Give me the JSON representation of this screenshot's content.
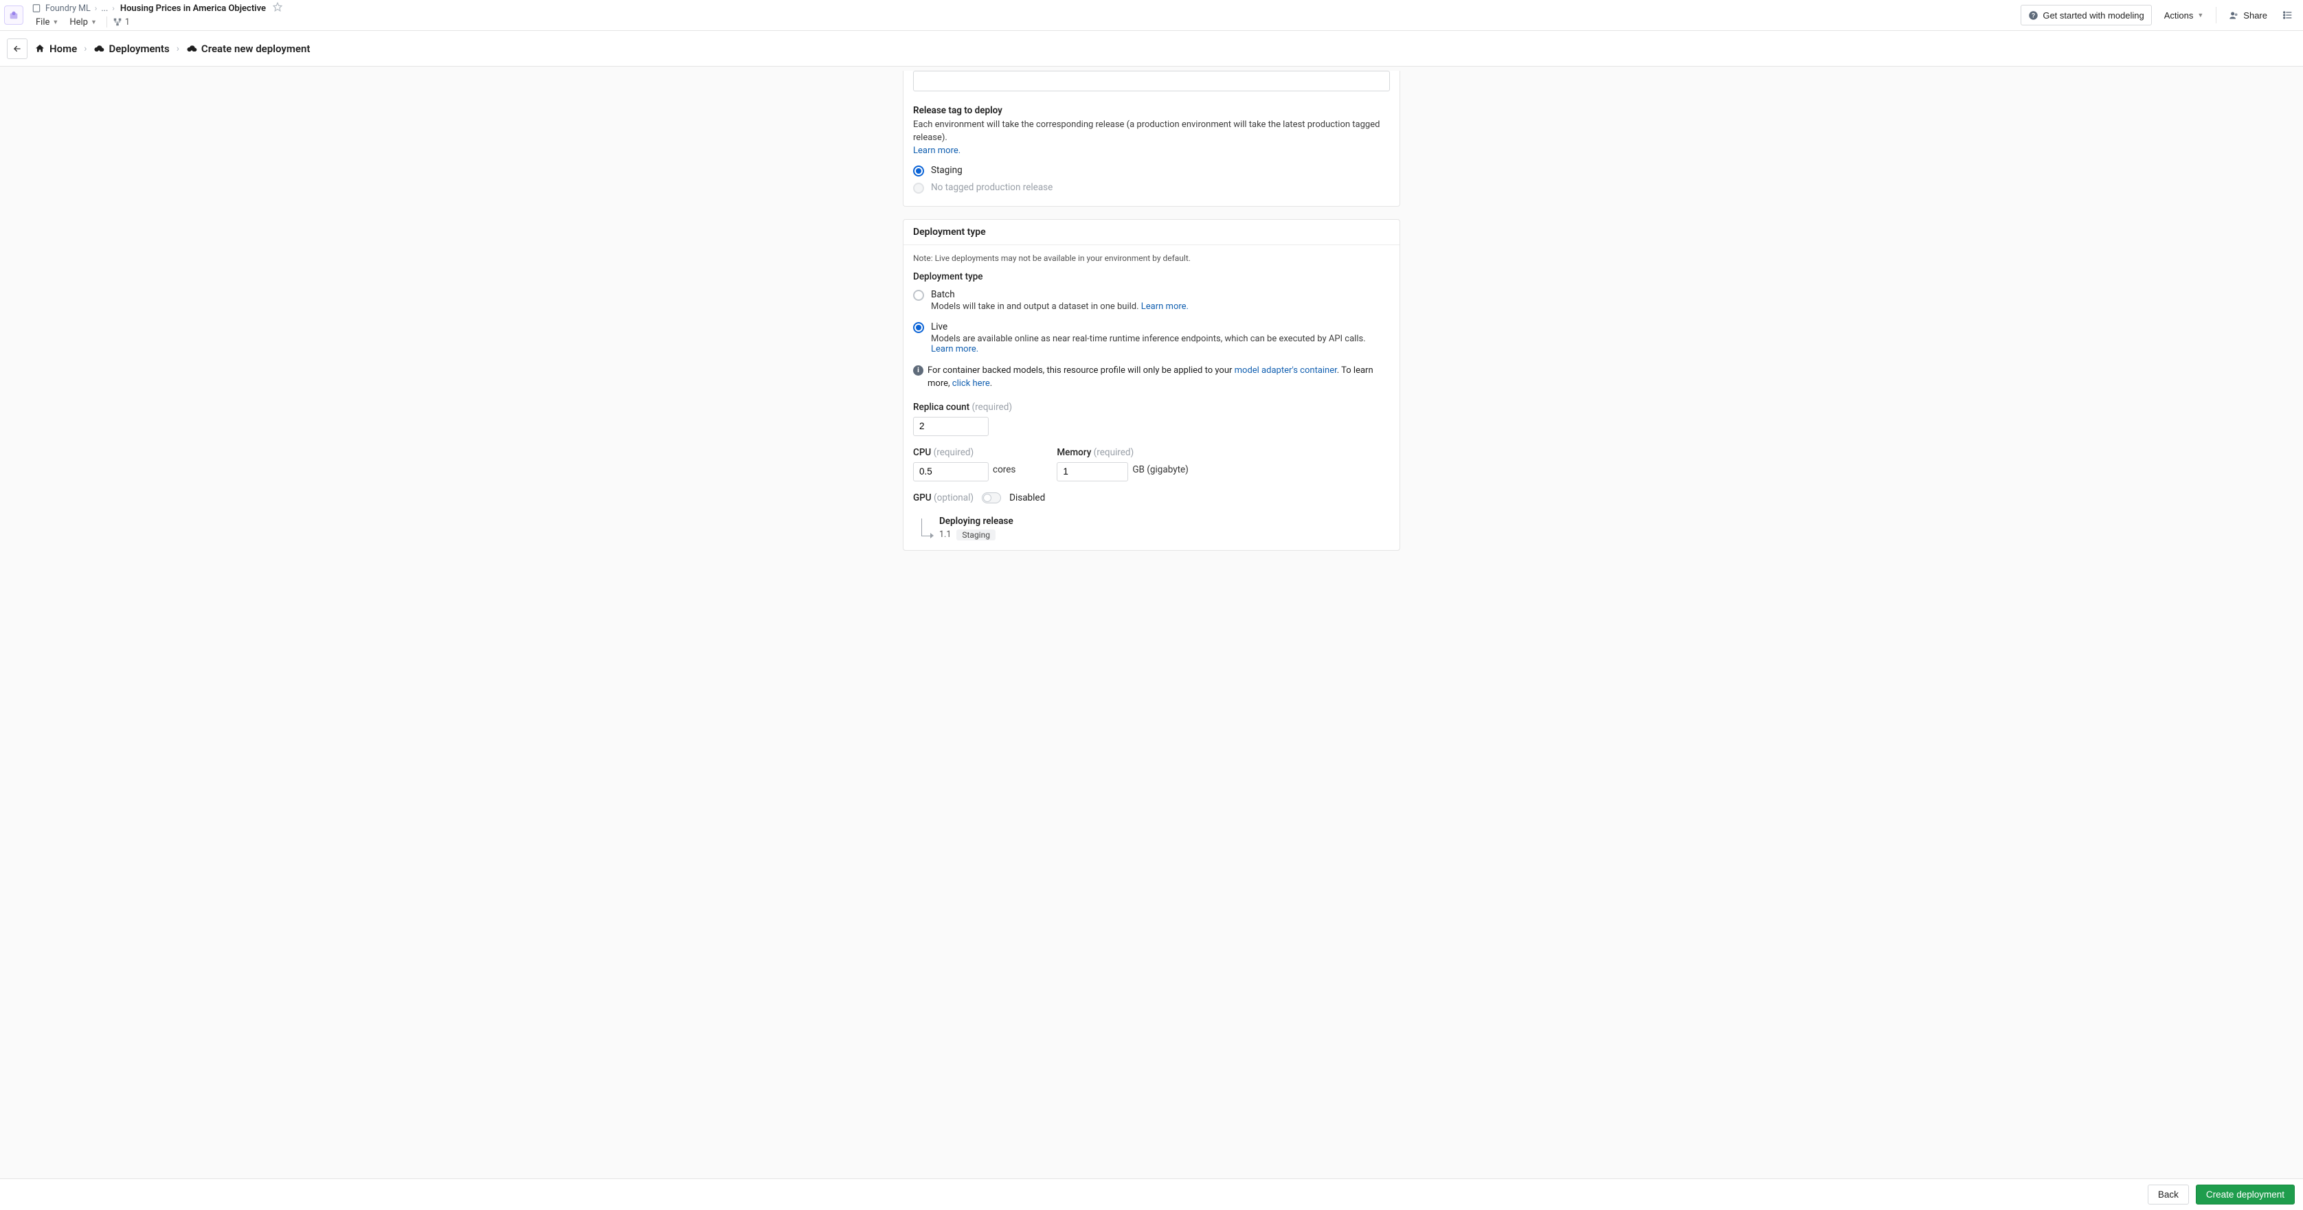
{
  "header": {
    "crumb_root": "Foundry ML",
    "crumb_trunc": "...",
    "crumb_title": "Housing Prices in America Objective",
    "menus": {
      "file": "File",
      "help": "Help",
      "user_count": "1"
    },
    "get_started": "Get started with modeling",
    "actions": "Actions",
    "share": "Share"
  },
  "nav": {
    "home": "Home",
    "deployments": "Deployments",
    "create": "Create new deployment"
  },
  "release_section": {
    "label": "Release tag to deploy",
    "desc": "Each environment will take the corresponding release (a production environment will take the latest production tagged release).",
    "learn_more": "Learn more.",
    "staging_label": "Staging",
    "no_prod_label": "No tagged production release"
  },
  "dep_type": {
    "header": "Deployment type",
    "note": "Note: Live deployments may not be available in your environment by default.",
    "label": "Deployment type",
    "batch_label": "Batch",
    "batch_desc": "Models will take in and output a dataset in one build. ",
    "batch_learn": "Learn more.",
    "live_label": "Live",
    "live_desc": "Models are available online as near real-time runtime inference endpoints, which can be executed by API calls. ",
    "live_learn": "Learn more.",
    "info_text_1": "For container backed models, this resource profile will only be applied to your ",
    "info_link_1": "model adapter's container",
    "info_text_2": ". To learn more, ",
    "info_link_2": "click here",
    "info_text_3": "."
  },
  "resources": {
    "replica_label": "Replica count ",
    "required": "(required)",
    "optional": "(optional)",
    "replica_value": "2",
    "cpu_label": "CPU ",
    "cpu_value": "0.5",
    "cpu_unit": "cores",
    "mem_label": "Memory ",
    "mem_value": "1",
    "mem_unit": "GB (gigabyte)",
    "gpu_label": "GPU ",
    "gpu_state": "Disabled"
  },
  "deploying": {
    "label": "Deploying release",
    "version": "1.1",
    "tag": "Staging"
  },
  "footer": {
    "back": "Back",
    "create": "Create deployment"
  }
}
